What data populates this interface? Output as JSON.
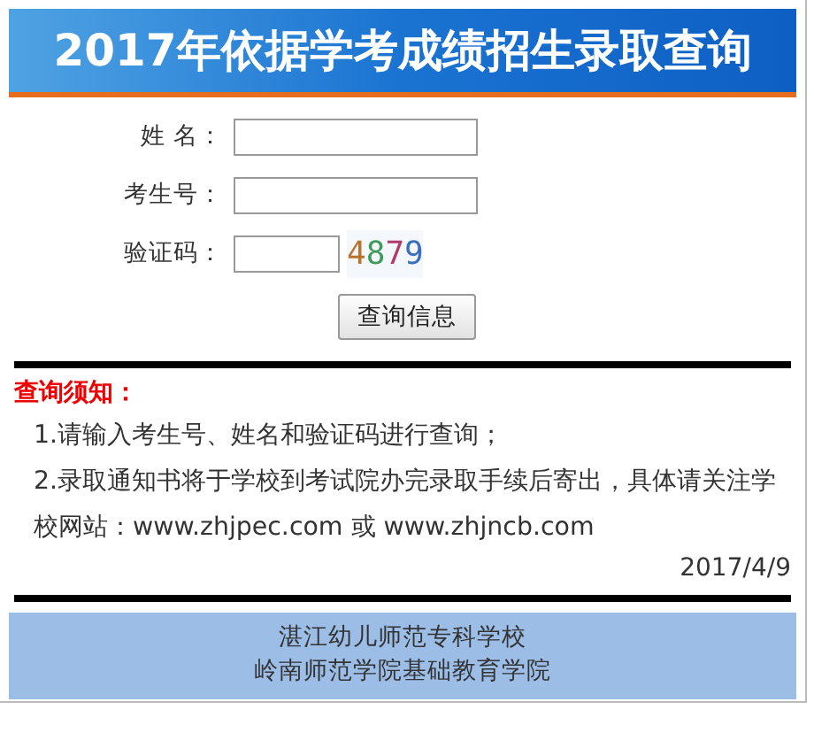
{
  "header": {
    "title": "2017年依据学考成绩招生录取查询"
  },
  "form": {
    "fields": [
      {
        "label": "姓 名：",
        "kind": "text"
      },
      {
        "label": "考生号：",
        "kind": "text"
      },
      {
        "label": "验证码：",
        "kind": "captcha"
      }
    ],
    "captcha": [
      {
        "text": "4",
        "color": "#b8732c"
      },
      {
        "text": "8",
        "color": "#3f9a5a"
      },
      {
        "text": "7",
        "color": "#b03a6a"
      },
      {
        "text": "9",
        "color": "#3a6fc0"
      }
    ],
    "button": "查询信息"
  },
  "notice": {
    "heading": "查询须知：",
    "items": [
      "1.请输入考生号、姓名和验证码进行查询；",
      "2.录取通知书将于学校到考试院办完录取手续后寄出，具体请关注学校网站：www.zhjpec.com 或 www.zhjncb.com"
    ],
    "date": "2017/4/9"
  },
  "footer": {
    "lines": [
      "湛江幼儿师范专科学校",
      "岭南师范学院基础教育学院"
    ]
  }
}
